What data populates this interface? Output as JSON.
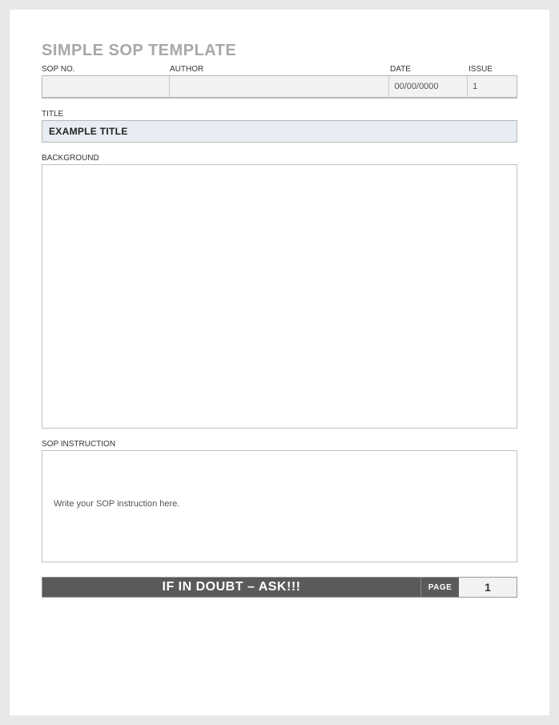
{
  "document": {
    "title": "SIMPLE SOP TEMPLATE"
  },
  "header": {
    "labels": {
      "sop_no": "SOP NO.",
      "author": "AUTHOR",
      "date": "DATE",
      "issue": "ISSUE"
    },
    "values": {
      "sop_no": "",
      "author": "",
      "date": "00/00/0000",
      "issue": "1"
    }
  },
  "sections": {
    "title_label": "TITLE",
    "title_value": "EXAMPLE TITLE",
    "background_label": "BACKGROUND",
    "background_value": "",
    "instruction_label": "SOP INSTRUCTION",
    "instruction_value": "Write your SOP instruction here."
  },
  "footer": {
    "message": "IF IN DOUBT – ASK!!!",
    "page_label": "PAGE",
    "page_number": "1"
  }
}
